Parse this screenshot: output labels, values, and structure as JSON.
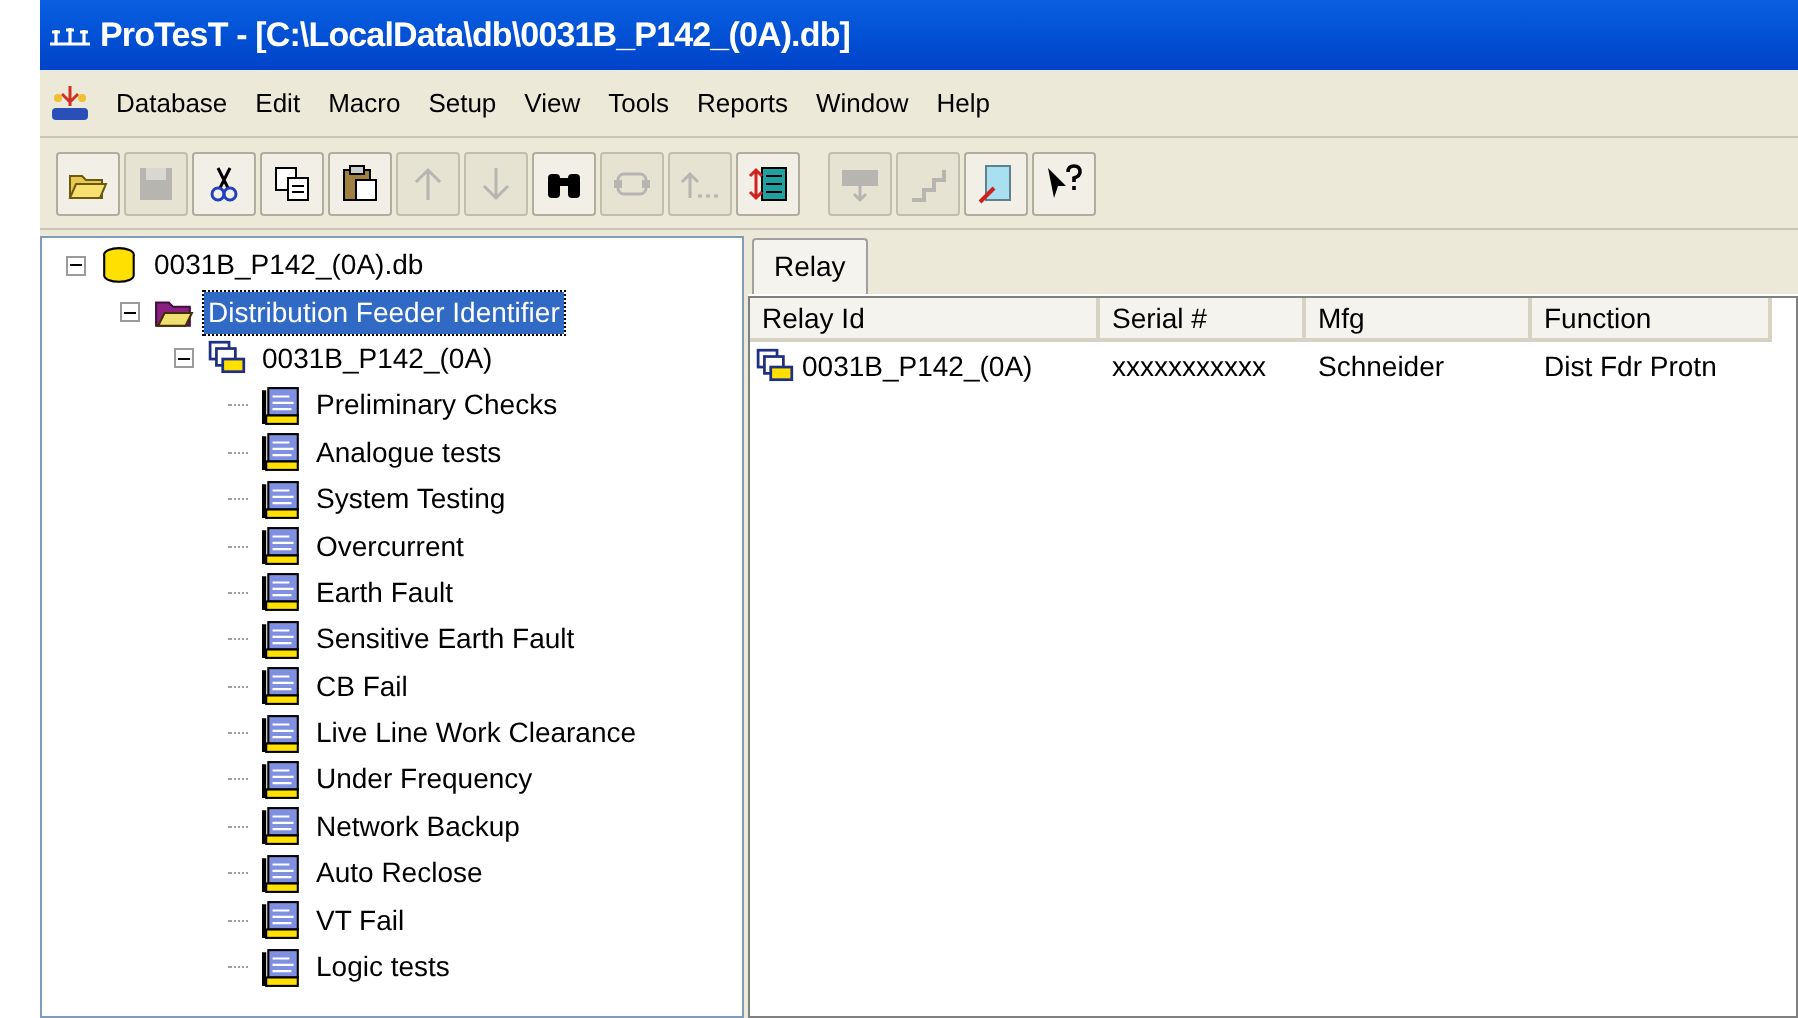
{
  "window": {
    "title": "ProTesT - [C:\\LocalData\\db\\0031B_P142_(0A).db]"
  },
  "menu": [
    "Database",
    "Edit",
    "Macro",
    "Setup",
    "View",
    "Tools",
    "Reports",
    "Window",
    "Help"
  ],
  "toolbar": [
    {
      "kind": "open",
      "disabled": false
    },
    {
      "kind": "save",
      "disabled": true
    },
    {
      "kind": "cut",
      "disabled": false
    },
    {
      "kind": "copy",
      "disabled": false
    },
    {
      "kind": "paste",
      "disabled": false
    },
    {
      "kind": "up",
      "disabled": true
    },
    {
      "kind": "down",
      "disabled": true
    },
    {
      "kind": "find",
      "disabled": false
    },
    {
      "kind": "link",
      "disabled": true
    },
    {
      "kind": "back",
      "disabled": true
    },
    {
      "kind": "sort",
      "disabled": false
    },
    {
      "kind": "sep"
    },
    {
      "kind": "board",
      "disabled": true
    },
    {
      "kind": "steps",
      "disabled": true
    },
    {
      "kind": "edit",
      "disabled": false
    },
    {
      "kind": "help",
      "disabled": false
    }
  ],
  "tree": [
    {
      "kind": "database",
      "label": "0031B_P142_(0A).db",
      "selected": false,
      "expanded": true,
      "children": [
        {
          "kind": "folder",
          "label": "Distribution Feeder Identifier",
          "selected": true,
          "expanded": true,
          "children": [
            {
              "kind": "relay",
              "label": "0031B_P142_(0A)",
              "selected": false,
              "expanded": true,
              "children": [
                {
                  "kind": "test",
                  "label": "Preliminary Checks",
                  "selected": false
                },
                {
                  "kind": "test",
                  "label": "Analogue tests",
                  "selected": false
                },
                {
                  "kind": "test",
                  "label": "System Testing",
                  "selected": false
                },
                {
                  "kind": "test",
                  "label": "Overcurrent",
                  "selected": false
                },
                {
                  "kind": "test",
                  "label": "Earth Fault",
                  "selected": false
                },
                {
                  "kind": "test",
                  "label": "Sensitive Earth Fault",
                  "selected": false
                },
                {
                  "kind": "test",
                  "label": "CB Fail",
                  "selected": false
                },
                {
                  "kind": "test",
                  "label": "Live Line Work Clearance",
                  "selected": false
                },
                {
                  "kind": "test",
                  "label": "Under Frequency",
                  "selected": false
                },
                {
                  "kind": "test",
                  "label": "Network Backup",
                  "selected": false
                },
                {
                  "kind": "test",
                  "label": "Auto Reclose",
                  "selected": false
                },
                {
                  "kind": "test",
                  "label": "VT Fail",
                  "selected": false
                },
                {
                  "kind": "test",
                  "label": "Logic tests",
                  "selected": false
                }
              ]
            }
          ]
        }
      ]
    }
  ],
  "tabs": [
    {
      "label": "Relay",
      "selected": true
    }
  ],
  "table": {
    "columns": [
      "Relay Id",
      "Serial #",
      "Mfg",
      "Function"
    ],
    "rows": [
      [
        "0031B_P142_(0A)",
        "xxxxxxxxxxx",
        "Schneider",
        "Dist Fdr Protn"
      ]
    ]
  }
}
